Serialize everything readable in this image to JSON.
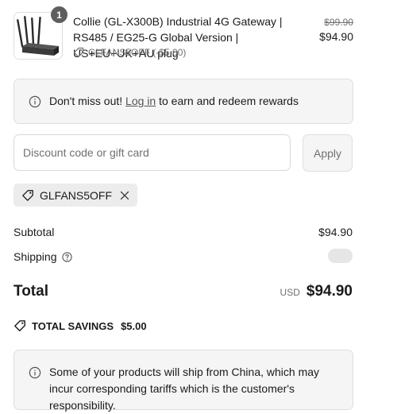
{
  "product": {
    "quantity": "1",
    "title": "Collie (GL-X300B) Industrial 4G Gateway | RS485 / EG25-G Global Version | US+EU+UK+AU plug",
    "discount_line": "GLFANS5OFF (-$5.00)",
    "compare_price": "$99.90",
    "price": "$94.90",
    "image_icon": "router-device-icon"
  },
  "rewards_notice": {
    "prefix": "Don't miss out!",
    "link": "Log in",
    "suffix": "to earn and redeem rewards"
  },
  "discount": {
    "placeholder": "Discount code or gift card",
    "value": "",
    "apply_label": "Apply"
  },
  "applied_code": {
    "code": "GLFANS5OFF"
  },
  "summary": {
    "subtotal_label": "Subtotal",
    "subtotal_value": "$94.90",
    "shipping_label": "Shipping",
    "total_label": "Total",
    "currency": "USD",
    "total_value": "$94.90",
    "savings_label": "TOTAL SAVINGS",
    "savings_value": "$5.00"
  },
  "shipping_notice": {
    "text": "Some of your products will ship from China, which may incur corresponding tariffs which is the customer's responsibility."
  },
  "colors": {
    "text": "#1a1a1a",
    "muted": "#707070",
    "border": "#dedede",
    "panel": "#f5f5f5",
    "badge": "#5e5e5e"
  }
}
